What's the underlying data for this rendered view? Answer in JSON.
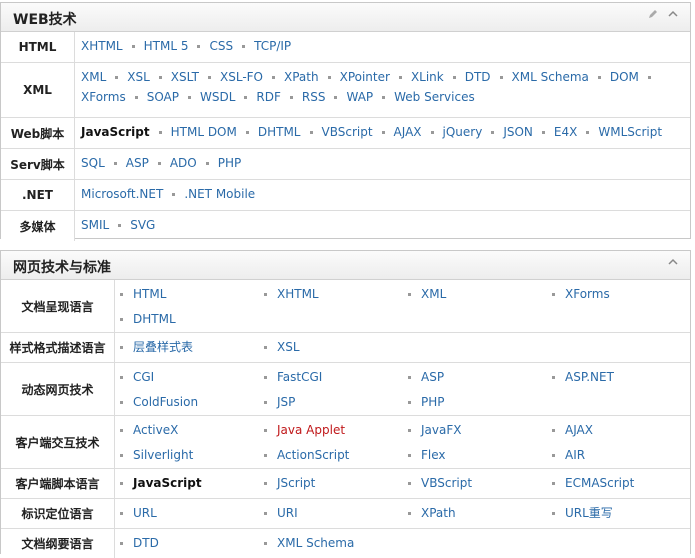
{
  "panel1": {
    "title": "WEB技术",
    "rows": [
      {
        "label": "HTML",
        "links": [
          "XHTML",
          "HTML 5",
          "CSS",
          "TCP/IP"
        ]
      },
      {
        "label": "XML",
        "links": [
          "XML",
          "XSL",
          "XSLT",
          "XSL-FO",
          "XPath",
          "XPointer",
          "XLink",
          "DTD",
          "XML Schema",
          "DOM",
          "XForms",
          "SOAP",
          "WSDL",
          "RDF",
          "RSS",
          "WAP",
          "Web Services"
        ]
      },
      {
        "label": "Web脚本",
        "links": [
          "JavaScript",
          "HTML DOM",
          "DHTML",
          "VBScript",
          "AJAX",
          "jQuery",
          "JSON",
          "E4X",
          "WMLScript"
        ]
      },
      {
        "label": "Serv脚本",
        "links": [
          "SQL",
          "ASP",
          "ADO",
          "PHP"
        ]
      },
      {
        "label": ".NET",
        "links": [
          "Microsoft.NET",
          ".NET Mobile"
        ]
      },
      {
        "label": "多媒体",
        "links": [
          "SMIL",
          "SVG"
        ]
      }
    ]
  },
  "panel2": {
    "title": "网页技术与标准",
    "rows": [
      {
        "label": "文档呈现语言",
        "links": [
          "HTML",
          "XHTML",
          "XML",
          "XForms",
          "DHTML"
        ]
      },
      {
        "label": "样式格式描述语言",
        "links": [
          "层叠样式表",
          "XSL"
        ]
      },
      {
        "label": "动态网页技术",
        "links": [
          "CGI",
          "FastCGI",
          "ASP",
          "ASP.NET",
          "ColdFusion",
          "JSP",
          "PHP"
        ]
      },
      {
        "label": "客户端交互技术",
        "links": [
          "ActiveX",
          "Java Applet",
          "JavaFX",
          "AJAX",
          "Silverlight",
          "ActionScript",
          "Flex",
          "AIR"
        ]
      },
      {
        "label": "客户端脚本语言",
        "links": [
          "JavaScript",
          "JScript",
          "VBScript",
          "ECMAScript"
        ]
      },
      {
        "label": "标识定位语言",
        "links": [
          "URL",
          "URI",
          "XPath",
          "URL重写"
        ]
      },
      {
        "label": "文档纲要语言",
        "links": [
          "DTD",
          "XML Schema"
        ]
      }
    ]
  },
  "colors": {
    "link": "#2a6aa8",
    "visited_red": "#c0181a",
    "bold_text": "#111111"
  },
  "icons": {
    "edit": "pencil-icon",
    "collapse": "chevron-up-icon"
  }
}
